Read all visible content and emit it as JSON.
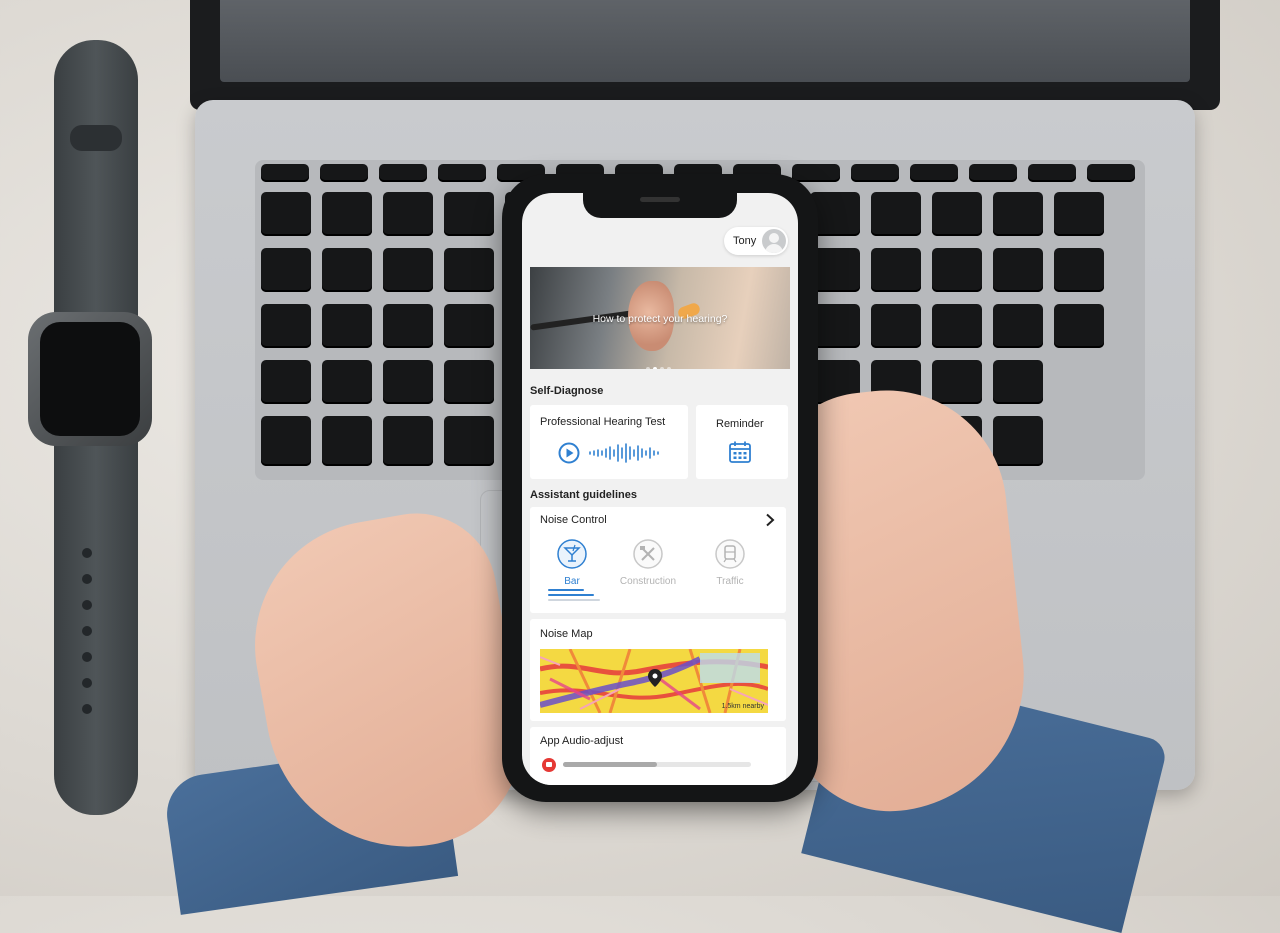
{
  "user": {
    "name": "Tony"
  },
  "banner": {
    "text": "How to protect your hearing?",
    "slides": 4,
    "active_slide": 2
  },
  "self_diagnose": {
    "title": "Self-Diagnose",
    "hearing_test_label": "Professional Hearing Test",
    "reminder_label": "Reminder"
  },
  "assistant": {
    "title": "Assistant guidelines",
    "noise_control": {
      "title": "Noise Control",
      "modes": [
        {
          "label": "Bar",
          "icon": "cocktail-icon",
          "active": true
        },
        {
          "label": "Construction",
          "icon": "tools-icon",
          "active": false
        },
        {
          "label": "Traffic",
          "icon": "train-icon",
          "active": false
        }
      ]
    },
    "noise_map": {
      "title": "Noise Map",
      "caption": "1.5km nearby"
    },
    "audio_adjust": {
      "title": "App Audio-adjust",
      "level": 0.5
    }
  },
  "colors": {
    "accent": "#2f80d1",
    "inactive": "#b3b3b3",
    "app_bg": "#f1f1f1"
  }
}
